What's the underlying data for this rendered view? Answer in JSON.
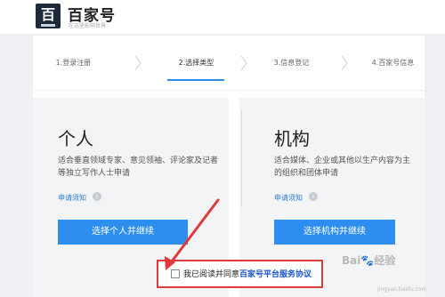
{
  "header": {
    "logo_glyph": "百",
    "brand": "百家号",
    "slogan": "在这里影响世界"
  },
  "steps": [
    {
      "label": "1.登录注册",
      "active": false
    },
    {
      "label": "2.选择类型",
      "active": true
    },
    {
      "label": "3.信息登记",
      "active": false
    },
    {
      "label": "4.百家号信息",
      "active": false
    }
  ],
  "personal": {
    "title": "个人",
    "desc": "适合垂直领域专家、意见领袖、评论家及记者等独立写作人士申请",
    "apply_note": "申请须知",
    "button": "选择个人并继续"
  },
  "org": {
    "title": "机构",
    "desc": "适合媒体、企业或其他以生产内容为主的组织和团体申请",
    "apply_note": "申请须知",
    "button": "选择机构并继续"
  },
  "agreement": {
    "prefix": "我已阅读并同意",
    "link": "百家号平台服务协议"
  },
  "watermark": {
    "text": "Bai🐾经验",
    "sub": "jingyan.baidu.com"
  },
  "colors": {
    "accent": "#2e8ef0",
    "annotation": "#e03a3a",
    "link": "#1a55c8"
  }
}
